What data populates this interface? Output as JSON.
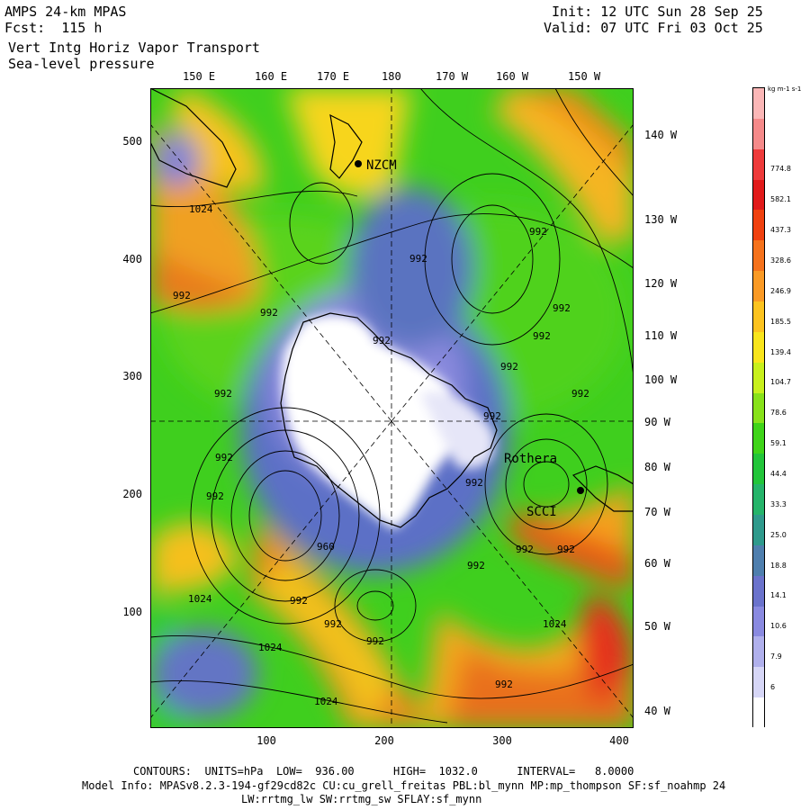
{
  "header": {
    "model": "AMPS 24-km MPAS",
    "fcst": "Fcst:  115 h",
    "init": "Init: 12 UTC Sun 28 Sep 25",
    "valid": "Valid: 07 UTC Fri 03 Oct 25",
    "field1": "Vert Intg Horiz Vapor Transport",
    "field2": "Sea-level pressure"
  },
  "top_lon_labels": [
    "150 E",
    "160 E",
    "170 E",
    "180",
    "170 W",
    "160 W",
    "150 W"
  ],
  "right_lon_labels": [
    "140 W",
    "130 W",
    "120 W",
    "110 W",
    "100 W",
    "90 W",
    "80 W",
    "70 W",
    "60 W",
    "50 W",
    "40 W"
  ],
  "left_axis": [
    "500",
    "400",
    "300",
    "200",
    "100"
  ],
  "bottom_axis": [
    "100",
    "200",
    "300",
    "400"
  ],
  "colorbar": {
    "units": "kg m-1 s-1",
    "ticks": [
      "774.8",
      "582.1",
      "437.3",
      "328.6",
      "246.9",
      "185.5",
      "139.4",
      "104.7",
      "78.6",
      "59.1",
      "44.4",
      "33.3",
      "25.0",
      "18.8",
      "14.1",
      "10.6",
      "7.9",
      "6"
    ],
    "colors": [
      "#fbb7b7",
      "#f58a8a",
      "#ee3b3b",
      "#e11a1a",
      "#f0410f",
      "#f5721c",
      "#fa9a25",
      "#fcc31f",
      "#f9e51c",
      "#c8f01d",
      "#88e21a",
      "#3fd419",
      "#22c53a",
      "#25b46a",
      "#2f9a8c",
      "#4f7fae",
      "#6b73cc",
      "#8a8ae0",
      "#b0b0ec",
      "#d6d6f6",
      "#ffffff"
    ]
  },
  "map_labels": {
    "station1": "NZCM",
    "station2": "Rothera",
    "station3": "SCCI",
    "contours": [
      "1024",
      "992",
      "992",
      "992",
      "992",
      "992",
      "992",
      "992",
      "992",
      "992",
      "992",
      "992",
      "992",
      "992",
      "992",
      "992",
      "992",
      "960",
      "992",
      "1024",
      "992",
      "992",
      "1024",
      "992",
      "1024",
      "992",
      "1024"
    ]
  },
  "footer": {
    "contours": "CONTOURS:  UNITS=hPa  LOW=  936.00      HIGH=  1032.0      INTERVAL=   8.0000",
    "model_info": "Model Info: MPASv8.2.3-194-gf29cd82c CU:cu_grell_freitas PBL:bl_mynn MP:mp_thompson SF:sf_noahmp 24",
    "radiation": "LW:rrtmg_lw SW:rrtmg_sw SFLAY:sf_mynn"
  }
}
